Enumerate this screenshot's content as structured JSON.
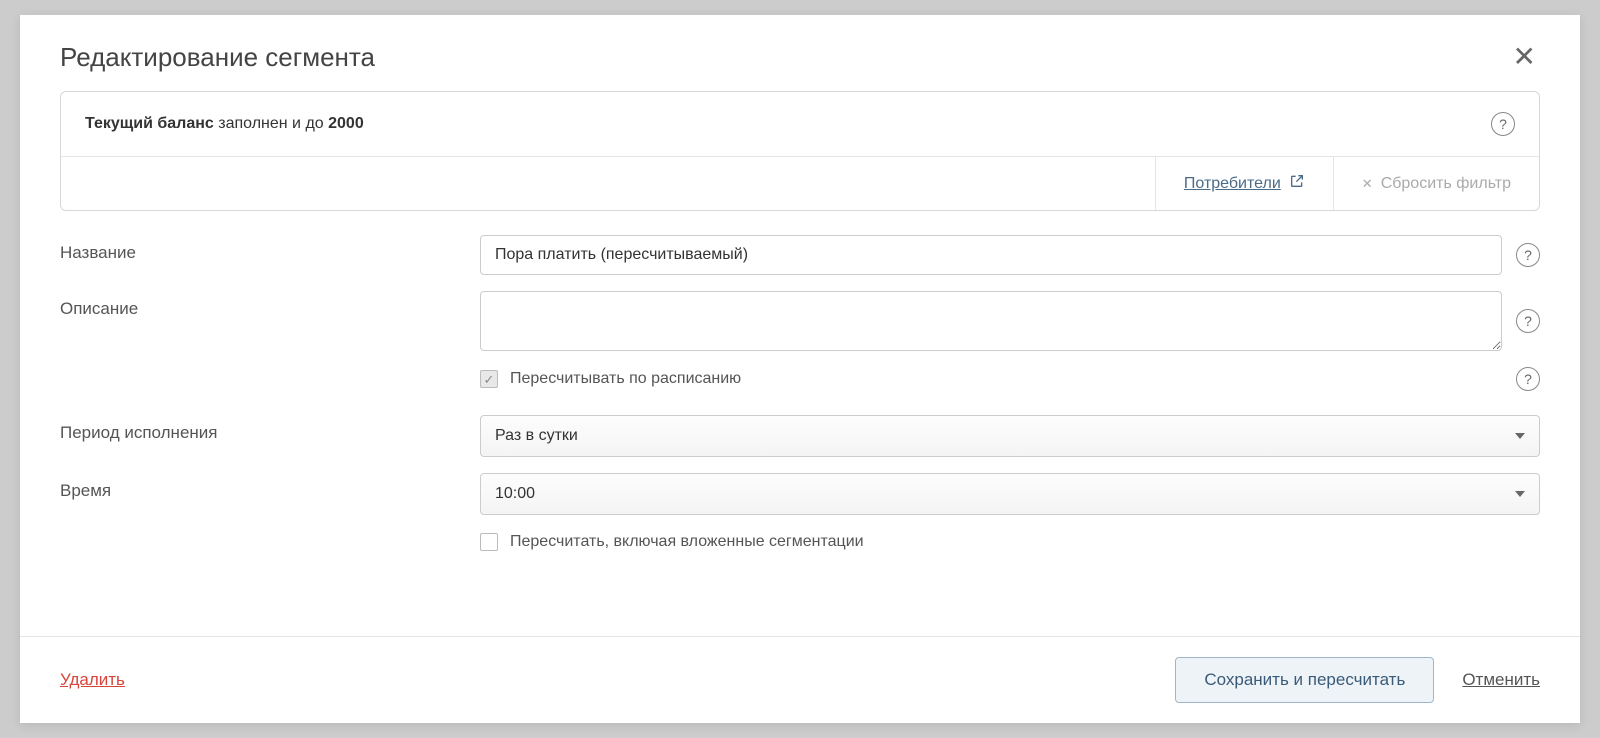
{
  "modal": {
    "title": "Редактирование сегмента"
  },
  "filter": {
    "field_label": "Текущий баланс",
    "middle_text": " заполнен и до ",
    "value": "2000",
    "consumers_label": "Потребители",
    "reset_label": "Сбросить фильтр"
  },
  "form": {
    "name_label": "Название",
    "name_value": "Пора платить (пересчитываемый)",
    "description_label": "Описание",
    "description_value": "",
    "recalc_schedule_label": "Пересчитывать по расписанию",
    "period_label": "Период исполнения",
    "period_value": "Раз в сутки",
    "time_label": "Время",
    "time_value": "10:00",
    "recalc_nested_label": "Пересчитать, включая вложенные сегментации"
  },
  "footer": {
    "delete_label": "Удалить",
    "save_label": "Сохранить и пересчитать",
    "cancel_label": "Отменить"
  }
}
